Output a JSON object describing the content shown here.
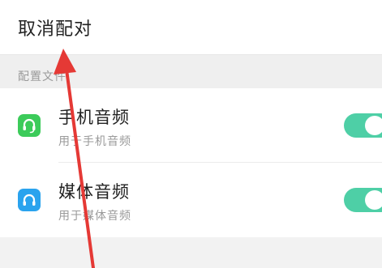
{
  "unpair": {
    "label": "取消配对"
  },
  "section": {
    "label": "配置文件"
  },
  "profiles": [
    {
      "title": "手机音频",
      "subtitle": "用于手机音频",
      "icon": "phone-headset-icon",
      "icon_color": "#3ccb5a",
      "enabled": true
    },
    {
      "title": "媒体音频",
      "subtitle": "用于媒体音频",
      "icon": "headphones-icon",
      "icon_color": "#2aa3ee",
      "enabled": true
    }
  ],
  "colors": {
    "toggle_on": "#4ecfa6",
    "annotation_arrow": "#e53935"
  }
}
